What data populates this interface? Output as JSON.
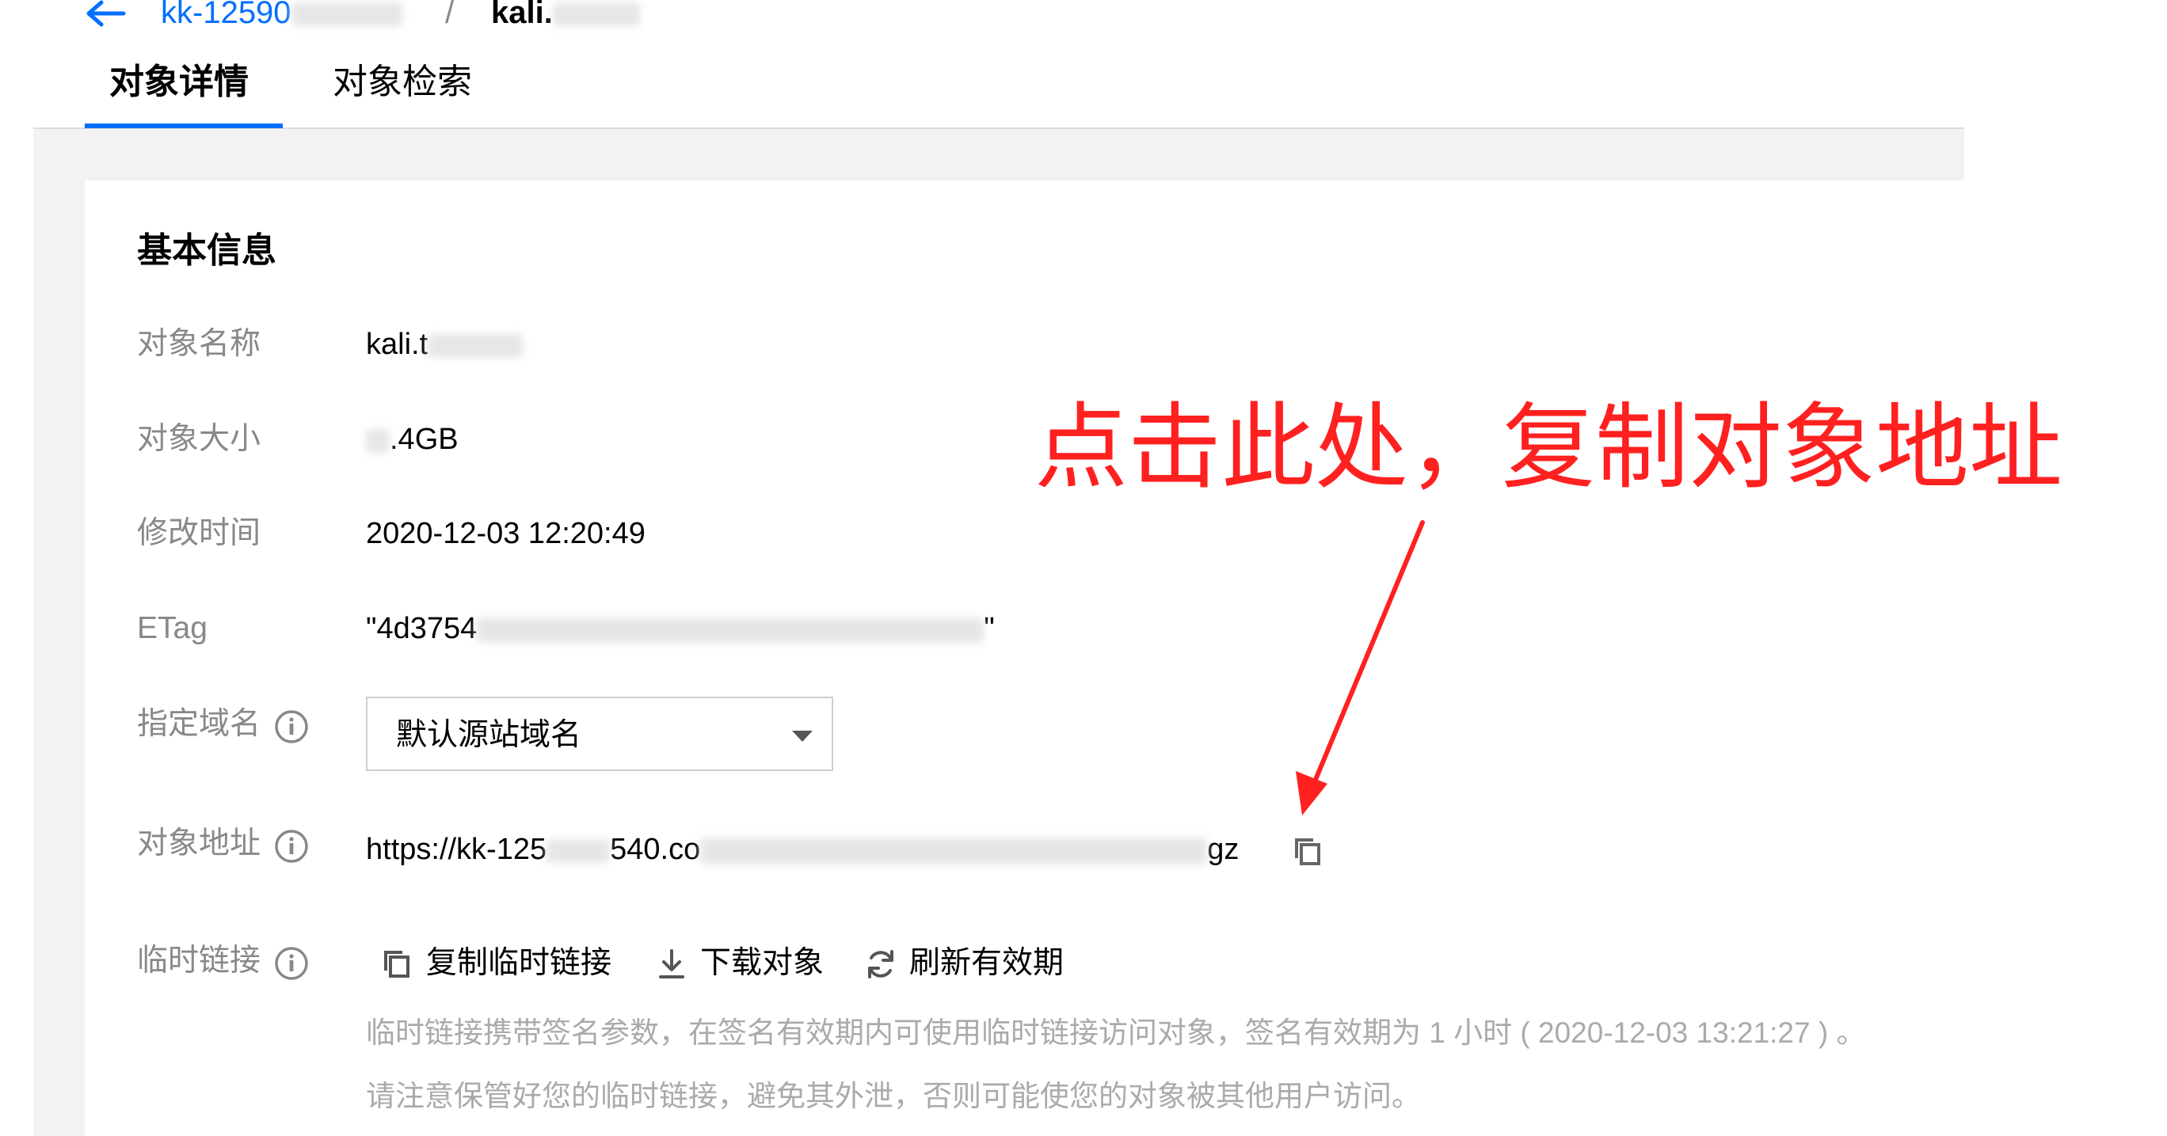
{
  "header": {
    "bucket_name": "kk-12590",
    "separator": "/",
    "object_name": "kali."
  },
  "tabs": [
    {
      "label": "对象详情",
      "active": true
    },
    {
      "label": "对象检索",
      "active": false
    }
  ],
  "basic_info": {
    "title": "基本信息",
    "fields": {
      "name": {
        "label": "对象名称",
        "value": "kali.t"
      },
      "size": {
        "label": "对象大小",
        "value": ".4GB"
      },
      "modified": {
        "label": "修改时间",
        "value": "2020-12-03 12:20:49"
      },
      "etag": {
        "label": "ETag",
        "value_start": "\"4d3754",
        "value_end": "\""
      },
      "domain": {
        "label": "指定域名",
        "selected": "默认源站域名"
      },
      "url": {
        "label": "对象地址",
        "value_start": "https://kk-125",
        "value_mid": "540.co",
        "value_end": "gz"
      },
      "temp_link": {
        "label": "临时链接"
      }
    }
  },
  "temp_link_actions": {
    "copy": "复制临时链接",
    "download": "下载对象",
    "refresh": "刷新有效期"
  },
  "temp_link_hint": {
    "line1": "临时链接携带签名参数，在签名有效期内可使用临时链接访问对象，签名有效期为 1 小时 ( 2020-12-03 13:21:27 ) 。",
    "line2": "请注意保管好您的临时链接，避免其外泄，否则可能使您的对象被其他用户访问。"
  },
  "annotation": {
    "text": "点击此处，复制对象地址"
  },
  "colors": {
    "accent": "#006eff",
    "annotation": "#ff2020",
    "label": "#888888",
    "hint": "#aaaaaa",
    "page_bg": "#f2f2f2"
  },
  "icons": {
    "back": "arrow-left-icon",
    "info": "info-circle-icon",
    "caret": "caret-down-icon",
    "copy": "copy-icon",
    "download": "download-icon",
    "refresh": "refresh-icon"
  }
}
